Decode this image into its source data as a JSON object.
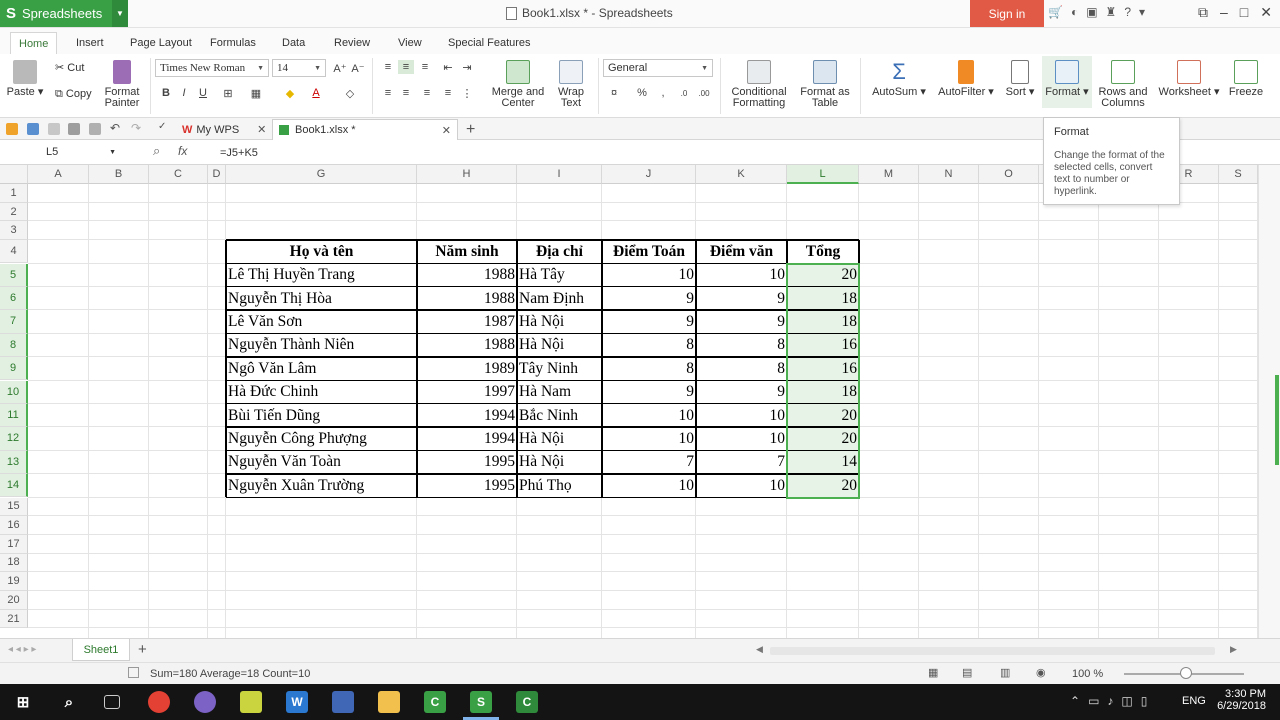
{
  "app": {
    "name": "Spreadsheets",
    "doc_title": "Book1.xlsx * - Spreadsheets",
    "signin": "Sign in"
  },
  "menu": {
    "tabs": [
      "Home",
      "Insert",
      "Page Layout",
      "Formulas",
      "Data",
      "Review",
      "View",
      "Special Features"
    ],
    "active": "Home"
  },
  "ribbon": {
    "paste": "Paste",
    "cut": "Cut",
    "copy": "Copy",
    "format_painter": "Format Painter",
    "font_name": "Times New Roman",
    "font_size": "14",
    "merge_center": "Merge and Center",
    "wrap_text": "Wrap Text",
    "number_format": "General",
    "conditional_formatting": "Conditional Formatting",
    "format_as_table": "Format as Table",
    "autosum": "AutoSum",
    "autofilter": "AutoFilter",
    "sort": "Sort",
    "format": "Format",
    "rows_columns": "Rows and Columns",
    "worksheet": "Worksheet",
    "freeze": "Freeze"
  },
  "doc_tabs": [
    {
      "label": "My WPS"
    },
    {
      "label": "Book1.xlsx *"
    }
  ],
  "formula_bar": {
    "cell_ref": "L5",
    "formula": "=J5+K5"
  },
  "tooltip": {
    "title": "Format",
    "body": "Change the format of the selected cells, convert text to number or hyperlink."
  },
  "columns": [
    "A",
    "B",
    "C",
    "D",
    "G",
    "H",
    "I",
    "J",
    "K",
    "L",
    "M",
    "N",
    "O",
    "P",
    "Q",
    "R",
    "S"
  ],
  "row_numbers": [
    "1",
    "2",
    "3",
    "4",
    "5",
    "6",
    "7",
    "8",
    "9",
    "10",
    "11",
    "12",
    "13",
    "14",
    "15",
    "16",
    "17",
    "18",
    "19",
    "20",
    "21"
  ],
  "table": {
    "headers": [
      "Họ và tên",
      "Năm sinh",
      "Địa chỉ",
      "Điểm Toán",
      "Điểm văn",
      "Tổng"
    ],
    "rows": [
      [
        "Lê Thị Huyền Trang",
        "1988",
        "Hà Tây",
        "10",
        "10",
        "20"
      ],
      [
        "Nguyễn Thị Hòa",
        "1988",
        "Nam Định",
        "9",
        "9",
        "18"
      ],
      [
        "Lê Văn Sơn",
        "1987",
        "Hà Nội",
        "9",
        "9",
        "18"
      ],
      [
        "Nguyễn Thành Niên",
        "1988",
        "Hà Nội",
        "8",
        "8",
        "16"
      ],
      [
        "Ngô Văn Lâm",
        "1989",
        "Tây Ninh",
        "8",
        "8",
        "16"
      ],
      [
        "Hà Đức Chinh",
        "1997",
        "Hà Nam",
        "9",
        "9",
        "18"
      ],
      [
        "Bùi Tiến Dũng",
        "1994",
        "Bắc Ninh",
        "10",
        "10",
        "20"
      ],
      [
        "Nguyễn Công Phượng",
        "1994",
        "Hà Nội",
        "10",
        "10",
        "20"
      ],
      [
        "Nguyễn Văn Toàn",
        "1995",
        "Hà Nội",
        "7",
        "7",
        "14"
      ],
      [
        "Nguyễn Xuân Trường",
        "1995",
        "Phú Thọ",
        "10",
        "10",
        "20"
      ]
    ]
  },
  "sheet_tabs": [
    "Sheet1"
  ],
  "status": {
    "summary": "Sum=180  Average=18  Count=10",
    "zoom": "100 %"
  },
  "taskbar": {
    "lang": "ENG",
    "time": "3:30 PM",
    "date": "6/29/2018"
  },
  "colors": {
    "accent": "#3aa046",
    "signin": "#e15a45",
    "selection": "#4caf50"
  }
}
